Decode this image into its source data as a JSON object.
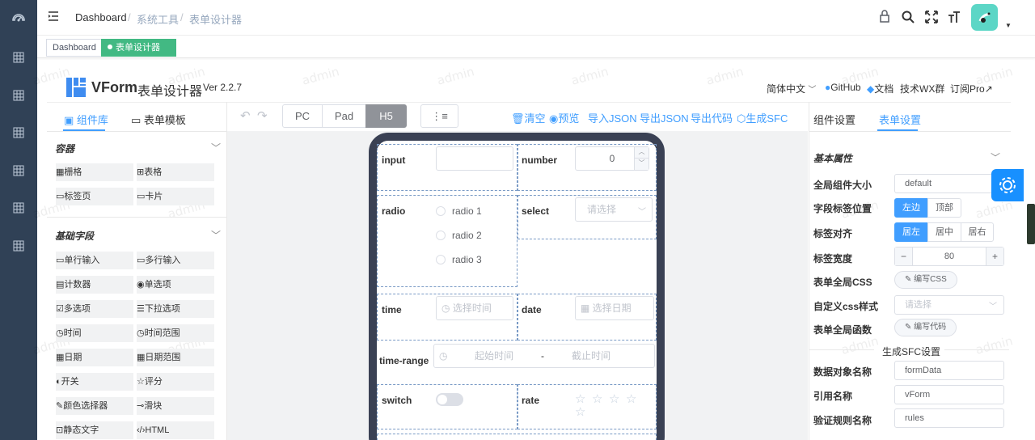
{
  "breadcrumb": [
    "Dashboard",
    "系统工具",
    "表单设计器"
  ],
  "breadcrumb_sep": "/",
  "tags": [
    {
      "label": "Dashboard"
    },
    {
      "label": "表单设计器",
      "close": "×"
    }
  ],
  "header": {
    "brand": "VForm",
    "title": "表单设计器",
    "version": "Ver 2.2.7",
    "lang": "简体中文",
    "github": "GitHub",
    "docs": "文档",
    "wx": "技术WX群",
    "pro": "订阅Pro"
  },
  "watermark": "admin",
  "left_panel": {
    "tabs": [
      "组件库",
      "表单模板"
    ],
    "container_title": "容器",
    "containers": [
      "栅格",
      "表格",
      "标签页",
      "卡片"
    ],
    "basic_title": "基础字段",
    "basics": [
      "单行输入",
      "多行输入",
      "计数器",
      "单选项",
      "多选项",
      "下拉选项",
      "时间",
      "时间范围",
      "日期",
      "日期范围",
      "开关",
      "评分",
      "颜色选择器",
      "滑块",
      "静态文字",
      "HTML"
    ]
  },
  "toolbar": {
    "devices": [
      "PC",
      "Pad",
      "H5"
    ],
    "active_device": "H5",
    "actions": [
      "清空",
      "预览",
      "导入JSON",
      "导出JSON",
      "导出代码",
      "生成SFC"
    ]
  },
  "form": {
    "input_label": "input",
    "number_label": "number",
    "number_value": "0",
    "radio_label": "radio",
    "radio_options": [
      "radio 1",
      "radio 2",
      "radio 3"
    ],
    "select_label": "select",
    "select_placeholder": "请选择",
    "time_label": "time",
    "time_placeholder": "选择时间",
    "date_label": "date",
    "date_placeholder": "选择日期",
    "time_range_label": "time-range",
    "range_start": "起始时间",
    "range_sep": "-",
    "range_end": "截止时间",
    "switch_label": "switch",
    "rate_label": "rate",
    "rate_value": 0,
    "rate_max": 5
  },
  "right_panel": {
    "tabs": [
      "组件设置",
      "表单设置"
    ],
    "basic_title": "基本属性",
    "size_label": "全局组件大小",
    "size_value": "default",
    "label_pos_label": "字段标签位置",
    "label_pos_options": [
      "左边",
      "顶部"
    ],
    "align_label": "标签对齐",
    "align_options": [
      "居左",
      "居中",
      "居右"
    ],
    "width_label": "标签宽度",
    "width_value": "80",
    "minus": "−",
    "plus": "+",
    "css_label": "表单全局CSS",
    "css_button": "编写CSS",
    "custom_css_label": "自定义css样式",
    "custom_css_placeholder": "请选择",
    "func_label": "表单全局函数",
    "func_button": "编写代码",
    "sfc_title": "生成SFC设置",
    "data_name_label": "数据对象名称",
    "data_name_value": "formData",
    "ref_label": "引用名称",
    "ref_value": "vForm",
    "rules_label": "验证规则名称",
    "rules_value": "rules"
  },
  "colors": {
    "sidebar": "#304156",
    "primary": "#409eff",
    "tag_active": "#42b983",
    "settings_fab": "#1890ff",
    "avatar": "#5cd6c6"
  }
}
